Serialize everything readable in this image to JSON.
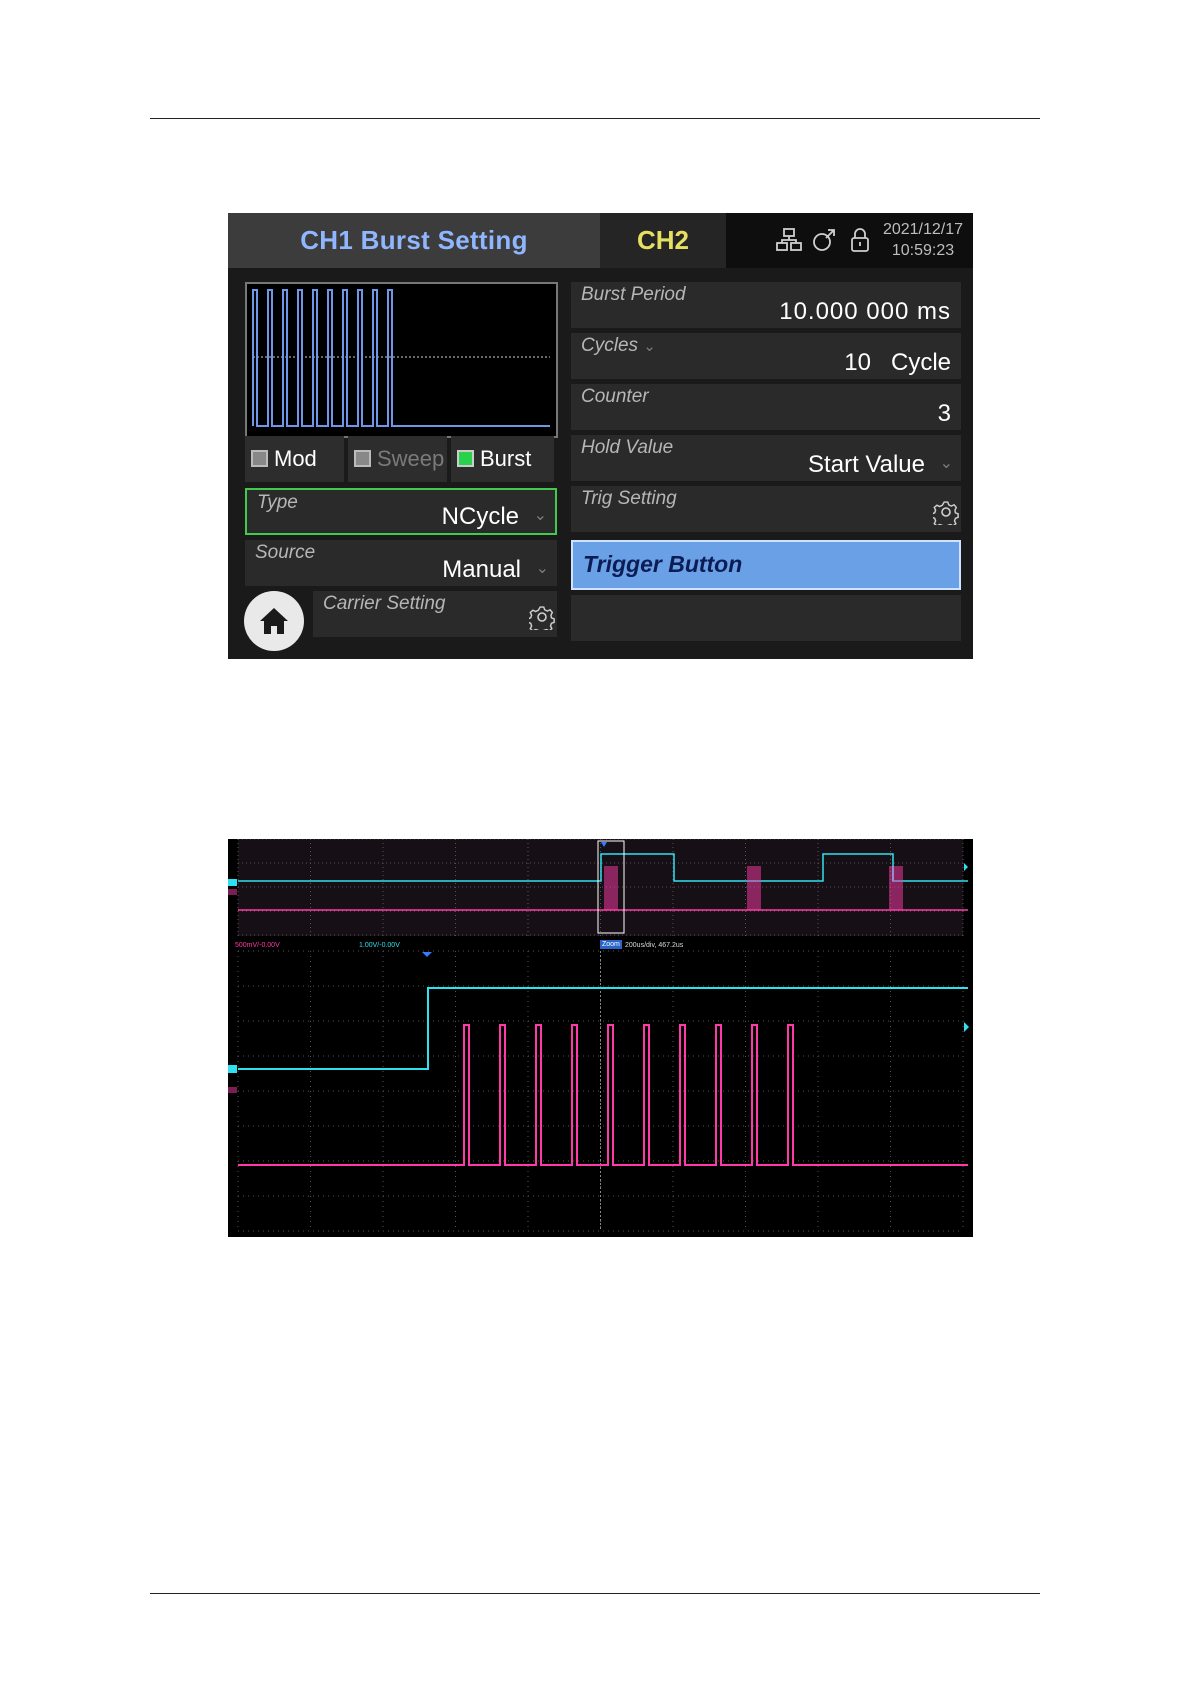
{
  "generator": {
    "title": "CH1 Burst Setting",
    "channel_tab": "CH2",
    "date": "2021/12/17",
    "time": "10:59:23",
    "status_icons": [
      "network-icon",
      "usb-icon",
      "lock-icon"
    ],
    "modes": [
      {
        "label": "Mod",
        "checked": false,
        "enabled": true
      },
      {
        "label": "Sweep",
        "checked": false,
        "enabled": false
      },
      {
        "label": "Burst",
        "checked": true,
        "enabled": true
      }
    ],
    "type": {
      "label": "Type",
      "value": "NCycle"
    },
    "source": {
      "label": "Source",
      "value": "Manual"
    },
    "carrier": {
      "label": "Carrier Setting"
    },
    "burst_period": {
      "label": "Burst Period",
      "value": "10.000 000 ms"
    },
    "cycles": {
      "label": "Cycles",
      "value": "10",
      "unit": "Cycle"
    },
    "counter": {
      "label": "Counter",
      "value": "3"
    },
    "hold_value": {
      "label": "Hold Value",
      "value": "Start Value"
    },
    "trig_setting": {
      "label": "Trig Setting"
    },
    "trigger_button": {
      "label": "Trigger Button"
    },
    "preview_pulse_count": 10
  },
  "scope": {
    "ch_tags": [
      "1",
      "2"
    ],
    "ch1_scale": "500mV/-0.00V",
    "ch2_scale": "1.00V/-0.00V",
    "zoom_label": "Zoom",
    "timebase": "200us/div, 467.2us",
    "colors": {
      "ch1": "#ff3aa8",
      "ch2": "#30e0f0",
      "grid": "#555555"
    },
    "zoomed_pulse_count": 10
  }
}
